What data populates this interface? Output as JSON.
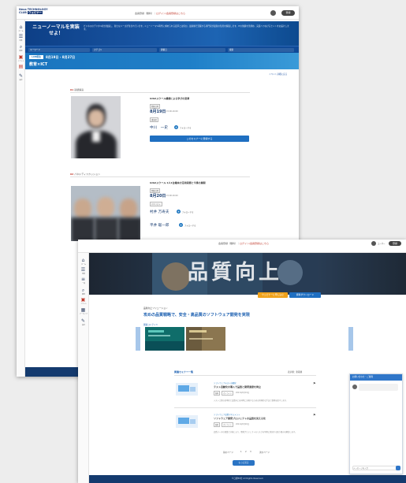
{
  "back": {
    "brand": {
      "line1": "Nexa TECHNOLOGY",
      "line2_badge": "ウェビナー",
      "line2": "CLUB"
    },
    "toplinks": {
      "text": "会員登録（無料）",
      "sep": "｜",
      "red": "ログイン/会員登録はこちら"
    },
    "signin_label": "登録",
    "hero": {
      "title": "ニューノーマルを実装せよ！",
      "desc": "ビジネスのデジタル化が加速し、新たなニーズが生まれています。ニューノーマル時代に求められる変革とは何か。最前線で活躍する専門家が最新の知見を解説します。ITの価値を見極め、実装へつなげるヒントをお届けします。"
    },
    "search": {
      "f1": "キーワード",
      "f2": "カテゴリ",
      "f3": "開催日",
      "f4": "検索"
    },
    "banner": {
      "tag": "LIVE配信",
      "date": "8月19日 - 8月27日",
      "title": "教育×ICT"
    },
    "share_link": "イベント詳細に戻る",
    "session1": {
      "mark": "01",
      "section": "基調講演",
      "subtitle": "GIGAスクール構想による学びの変革",
      "tag1": "開催日時",
      "date": "8月19日",
      "date_sub": "15:00-16:00",
      "tag2": "講演者",
      "name": "中川　一史",
      "follow": "フォローする",
      "register": "このセミナーに登録する"
    },
    "session2": {
      "mark": "02",
      "section": "パネルディスカッション",
      "subtitle": "GIGAスクール 1人1台端末の活用実態と今後の展開",
      "tag1": "開催日時",
      "date": "8月20日",
      "date_sub": "15:00-16:00",
      "tag2": "パネリスト",
      "name1": "村井 万寿夫",
      "name2": "平井 聡一郎",
      "follow": "フォローする"
    },
    "nav": [
      "ホーム",
      "特集",
      "検索",
      "イベント",
      "設定"
    ]
  },
  "front": {
    "toplinks": {
      "text": "会員登録（無料）",
      "sep": "｜",
      "red": "ログイン/会員登録はこちら"
    },
    "user_label": "ユーザー",
    "signin_label": "登録",
    "hero_words": "品質向上",
    "btn_primary": "ウェビナーに申し込む",
    "btn_secondary": "資料ダウンロード",
    "section_label": "品質向上ソリューション",
    "headline": "攻めの品質戦略で、安全・高品質のソフトウェア開発を実現",
    "featured_label": "関連コンテンツ",
    "list_head": "関連セミナー一覧",
    "sort_label": "表示順：新着順",
    "items": [
      {
        "category": "ソフトウェアテスト自動化",
        "title": "テスト自動化の導入で品質と開発速度を両立",
        "tag1": "無料",
        "tag2": "オンライン",
        "date": "2021年8月19日",
        "desc": "テスト工程の効率化と品質向上を同時に実現するための具体的な手法と事例を紹介します。"
      },
      {
        "category": "ソフトウェア品質マネジメント",
        "title": "ソフトウェア開発プロジェクトの品質を見える化",
        "tag1": "無料",
        "tag2": "オンライン",
        "date": "2021年8月26日",
        "desc": "品質データの収集と分析により、開発プロジェクトのリスクを早期に発見する取り組みを解説します。"
      }
    ],
    "pagination": [
      "前のページ",
      "1",
      "2",
      "3",
      "次のページ"
    ],
    "more_btn": "もっと見る",
    "footer": "©日経BP社 All Rights Reserved.",
    "chat": {
      "title": "お問い合わせ・ご質問",
      "input_ph": "メッセージを入力"
    },
    "nav": [
      "ホーム",
      "特集",
      "一覧",
      "検索",
      "イベント",
      "アーカイブ",
      "設定"
    ]
  }
}
